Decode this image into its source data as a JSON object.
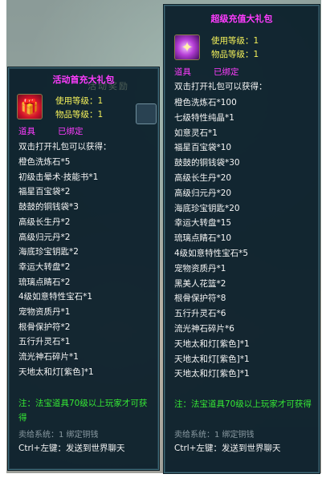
{
  "left_tooltip": {
    "background_text": "活动奖励",
    "title": "活动首充大礼包",
    "icon": "red-gift-box-icon",
    "use_level": "使用等级：1",
    "item_level": "物品等级：1",
    "type": "道具",
    "bound": "已绑定",
    "intro": "双击打开礼包可以获得：",
    "items": [
      "橙色洗炼石*5",
      "初级击晕术·技能书*1",
      "福星百宝袋*2",
      "鼓鼓的铜钱袋*3",
      "高级长生丹*2",
      "高级归元丹*2",
      "海底珍宝钥匙*2",
      "幸运大转盘*2",
      "琉璃点睛石*2",
      "4级如意特性宝石*1",
      "宠物资质丹*1",
      "根骨保护符*2",
      "五行升灵石*1",
      "流光神石碎片*1",
      "天地太和灯[紫色]*1"
    ],
    "note": "注：法宝道具70级以上玩家才可获得",
    "sale": "卖给系统：1 绑定铜钱",
    "ctrl": "Ctrl+左键：发送到世界聊天"
  },
  "right_tooltip": {
    "title": "超级充值大礼包",
    "icon": "purple-gift-box-icon",
    "use_level": "使用等级：1",
    "item_level": "物品等级：1",
    "type": "道具",
    "bound": "已绑定",
    "intro": "双击打开礼包可以获得：",
    "items": [
      "橙色洗炼石*100",
      "七级特性纯晶*1",
      "如意灵石*1",
      "福星百宝袋*10",
      "鼓鼓的铜钱袋*30",
      "高级长生丹*20",
      "高级归元丹*20",
      "海底珍宝钥匙*20",
      "幸运大转盘*15",
      "琉璃点睛石*10",
      "4级如意特性宝石*5",
      "宠物资质丹*1",
      "黑美人花篮*2",
      "根骨保护符*8",
      "五行升灵石*6",
      "流光神石碎片*6",
      "天地太和灯[紫色]*1",
      "天地太和灯[紫色]*1",
      "天地太和灯[紫色]*1"
    ],
    "note": "注：法宝道具70级以上玩家才可获得",
    "sale": "卖给系统：1 绑定铜钱",
    "ctrl": "Ctrl+左键：发送到世界聊天"
  },
  "colors": {
    "title": "#ff3cff",
    "level_text": "#f4f15a",
    "note": "#35e835",
    "panel_bg": "#081c28"
  }
}
